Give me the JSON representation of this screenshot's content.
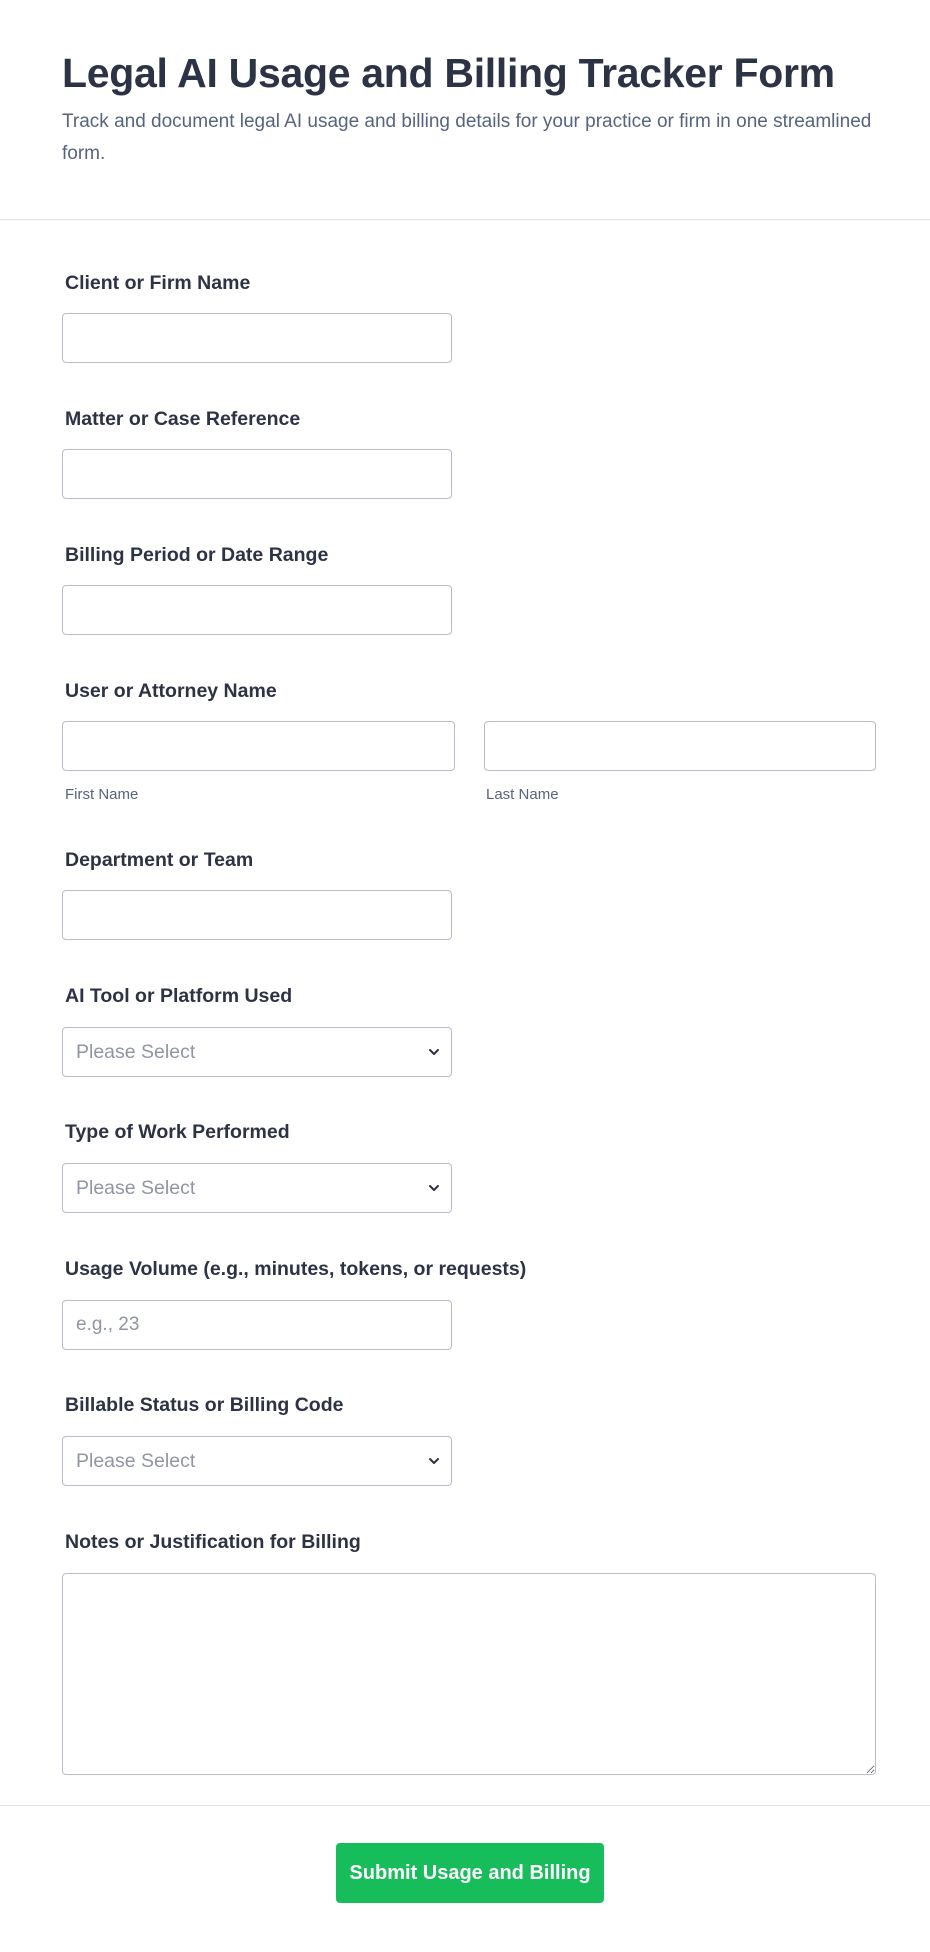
{
  "form": {
    "title": "Legal AI Usage and Billing Tracker Form",
    "description": "Track and document legal AI usage and billing details for your practice or firm in one streamlined form."
  },
  "fields": {
    "client_name": {
      "label": "Client or Firm Name",
      "value": ""
    },
    "matter_reference": {
      "label": "Matter or Case Reference",
      "value": ""
    },
    "billing_period": {
      "label": "Billing Period or Date Range",
      "value": ""
    },
    "user_name": {
      "label": "User or Attorney Name",
      "first_sublabel": "First Name",
      "last_sublabel": "Last Name",
      "first_value": "",
      "last_value": ""
    },
    "department": {
      "label": "Department or Team",
      "value": ""
    },
    "ai_tool": {
      "label": "AI Tool or Platform Used",
      "selected": "Please Select"
    },
    "work_type": {
      "label": "Type of Work Performed",
      "selected": "Please Select"
    },
    "usage_volume": {
      "label": "Usage Volume (e.g., minutes, tokens, or requests)",
      "placeholder": "e.g., 23",
      "value": ""
    },
    "billable_status": {
      "label": "Billable Status or Billing Code",
      "selected": "Please Select"
    },
    "notes": {
      "label": "Notes or Justification for Billing",
      "value": ""
    }
  },
  "submit": {
    "label": "Submit Usage and Billing"
  },
  "icons": {
    "select_arrow": "chevron-down-icon",
    "textarea_resize": "resize-handle-icon"
  },
  "colors": {
    "accent": "#18bd5b",
    "text": "#2c3345",
    "muted": "#57647e",
    "border": "#b8bdc9"
  }
}
